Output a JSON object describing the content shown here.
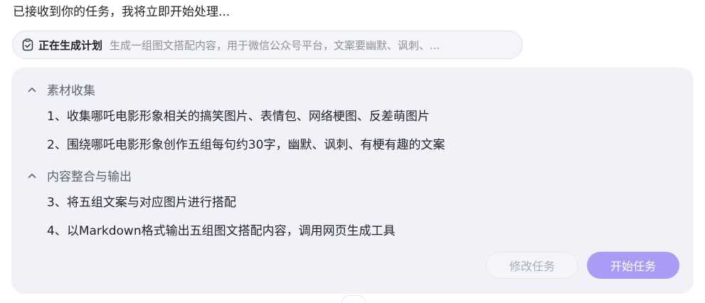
{
  "intro_text": "已接收到你的任务，我将立即开始处理...",
  "plan": {
    "icon": "clipboard-check-icon",
    "status_label": "正在生成计划",
    "description": "生成一组图文搭配内容，用于微信公众号平台，文案要幽默、讽刺、..."
  },
  "sections": [
    {
      "title": "素材收集",
      "chevron": "chevron-up-icon",
      "tasks": [
        "1、收集哪吒电影形象相关的搞笑图片、表情包、网络梗图、反差萌图片",
        "2、围绕哪吒电影形象创作五组每句约30字，幽默、讽刺、有梗有趣的文案"
      ]
    },
    {
      "title": "内容整合与输出",
      "chevron": "chevron-up-icon",
      "tasks": [
        "3、将五组文案与对应图片进行搭配",
        "4、以Markdown格式输出五组图文搭配内容，调用网页生成工具"
      ]
    }
  ],
  "actions": {
    "modify_label": "修改任务",
    "start_label": "开始任务"
  },
  "colors": {
    "card_bg": "#f1f2f7",
    "accent": "#a99cf7",
    "muted_text": "#8a8f99"
  }
}
